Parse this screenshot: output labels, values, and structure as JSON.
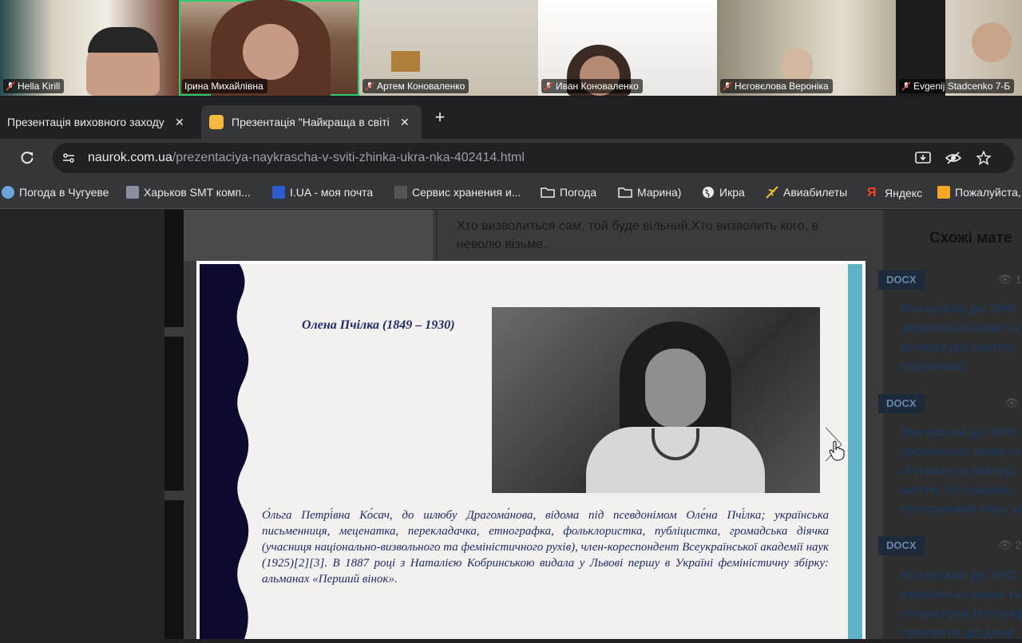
{
  "participants": [
    {
      "name": "Hella Kirill"
    },
    {
      "name": "Ірина Михайлівна"
    },
    {
      "name": "Артем Коноваленко"
    },
    {
      "name": "Иван Коноваленко"
    },
    {
      "name": "Нєговєлова Вероніка"
    },
    {
      "name": "Evgenij Stadcenko 7-Б"
    }
  ],
  "tabs": [
    {
      "title": "Презентація виховного заходу"
    },
    {
      "title": "Презентація \"Найкраща в світі"
    }
  ],
  "address": {
    "host": "naurok.com.ua",
    "path": "/prezentaciya-naykrascha-v-sviti-zhinka-ukra-nka-402414.html"
  },
  "bookmarks": [
    {
      "label": "Погода в Чугуеве"
    },
    {
      "label": "Харьков SMT комп..."
    },
    {
      "label": "I.UA - моя почта"
    },
    {
      "label": "Сервис хранения и..."
    },
    {
      "label": "Погода"
    },
    {
      "label": "Марина)"
    },
    {
      "label": "Икра"
    },
    {
      "label": "Авиабилеты"
    },
    {
      "label": "Яндекс"
    },
    {
      "label": "Пожалуйста,"
    }
  ],
  "page": {
    "quote": "Хто визволиться сам, той буде вільний,Хто визволить кого, в неволю візьме.",
    "similar_title": "Схожі мате",
    "similar": [
      {
        "badge": "DOCX",
        "views": "1",
        "text": "Матеріали до ЗНО українська мова та література (автор, персонаж)"
      },
      {
        "badge": "DOCX",
        "views": "",
        "text": "Матеріали до ЗНО українська мова та література (автор, життя, літ.напрям, програмний твір, ж"
      },
      {
        "badge": "DOCX",
        "views": "2",
        "text": "Матеріали до ЗНО українська мова та література (епіграф присвяти до двор"
      }
    ]
  },
  "slide": {
    "title": "Олена Пчілка (1849 – 1930)",
    "text": "О́льга Петрі́вна Ко́сач, до шлюбу Драгома́нова, відома під псевдонімом Оле́на Пчі́лка; українська письменниця, меценатка, перекладачка, етнографка, фольклористка, публіцистка, громадська діячка (учасниця національно-визвольного та феміністичного рухів), член-кореспондент Всеукраїнської академії наук (1925)[2][3]. В 1887 році з Наталією Кобринською видала у Львові першу в Україні феміністичну збірку: альманах «Перший вінок»."
  },
  "colors": {
    "active_speaker": "#2ecc71",
    "slide_wave": "#0c0a2e",
    "slide_bar": "#5cb3c7",
    "slide_text": "#1f2a6b"
  }
}
